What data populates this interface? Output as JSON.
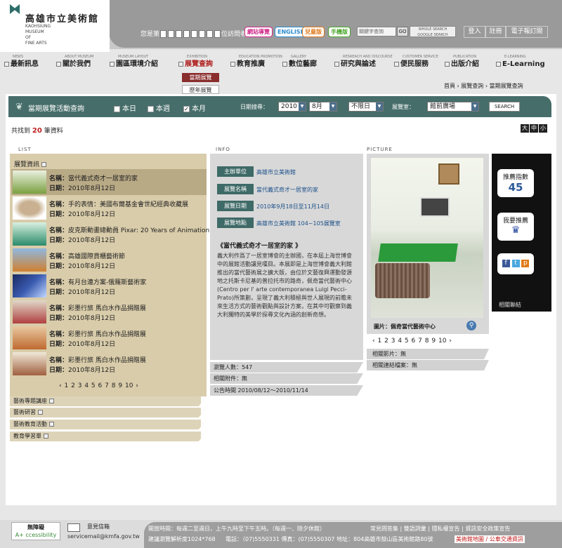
{
  "header": {
    "logo_cn": "高雄市立美術館",
    "logo_en": [
      "KAOHSIUNG",
      "MUSEUM",
      "OF",
      "FINE ARTS"
    ],
    "visitor_prefix": "您是第",
    "visitor_suffix": "位訪問者",
    "tag_buttons": [
      {
        "label": "網站導覽",
        "color": "#d02a8a"
      },
      {
        "label": "ENGLISH",
        "color": "#2a8ad0"
      },
      {
        "label": "兒童版",
        "color": "#e07a1a"
      },
      {
        "label": "手機版",
        "color": "#4aa62a"
      }
    ],
    "search_placeholder": "關鍵字查詢",
    "go_label": "GO",
    "whole_search": "WHOLE SEARCH",
    "google_search": "GOOGLE SEARCH",
    "right_buttons": [
      "登入",
      "註冊",
      "電子報訂閱"
    ]
  },
  "nav": [
    {
      "sub": "NEWS",
      "label": "最新訊息"
    },
    {
      "sub": "ABOUT MUSEUM",
      "label": "關於我們"
    },
    {
      "sub": "MUSEUM LAYOUT",
      "label": "園區環境介紹"
    },
    {
      "sub": "EXHIBITION",
      "label": "展覽查詢"
    },
    {
      "sub": "EDUCATION PROMOTION",
      "label": "教育推廣"
    },
    {
      "sub": "GALLERY",
      "label": "數位藝廊"
    },
    {
      "sub": "RESREACH AND DISCOURSE",
      "label": "研究與論述"
    },
    {
      "sub": "CUSTOMER SERVICE",
      "label": "便民服務"
    },
    {
      "sub": "PUBLICATION",
      "label": "出版介紹"
    },
    {
      "sub": "E-LEARNING",
      "label": "E-Learning"
    }
  ],
  "submenu": [
    "當期展覽",
    "歷年展覽"
  ],
  "breadcrumb": "首頁 › 展覽查詢 › 當期展覽查詢",
  "filter": {
    "title": "當期展覽活動查詢",
    "options": [
      {
        "label": "本日",
        "checked": false
      },
      {
        "label": "本週",
        "checked": false
      },
      {
        "label": "本月",
        "checked": true
      }
    ],
    "date_label": "日期搜尋：",
    "year": "2010",
    "month": "8月",
    "range": "不限日",
    "hall_label": "展覽室：",
    "hall": "館前廣場",
    "search_label": "SEARCH"
  },
  "found": {
    "prefix": "共找到",
    "count": "20",
    "suffix": "筆資料"
  },
  "font_sizes": [
    "大",
    "中",
    "小"
  ],
  "sections": {
    "list": "LIST",
    "info": "INFO",
    "picture": "PICTURE"
  },
  "list": {
    "header": "展覽資訊",
    "name_label": "名稱：",
    "date_label": "日期：",
    "items": [
      {
        "name": "當代義式奇才一居室的家",
        "date": "2010年8月12日",
        "thumb": "#7aa040"
      },
      {
        "name": "手的表情：美國布爾基金會世紀經典收藏展",
        "date": "2010年8月12日",
        "thumb": "#c8b090"
      },
      {
        "name": "皮克斯動畫總動員 Pixar: 20 Years of Animation",
        "date": "2010年8月12日",
        "thumb": "#2a8a6a"
      },
      {
        "name": "高雄國際貨櫃藝術節",
        "date": "2010年8月12日",
        "thumb": "#d08030"
      },
      {
        "name": "有月台連方案-俄羅斯藝術家",
        "date": "2010年8月12日",
        "thumb": "#3a5ab0"
      },
      {
        "name": "彩墨行旅 馬白水作品捐贈展",
        "date": "2010年8月12日",
        "thumb": "#b04040"
      },
      {
        "name": "彩墨行旅 馬白水作品捐贈展",
        "date": "2010年8月12日",
        "thumb": "#c06a30"
      },
      {
        "name": "彩墨行旅 馬白水作品捐贈展",
        "date": "2010年8月12日",
        "thumb": "#a06040"
      }
    ],
    "pagination": [
      "‹",
      "1",
      "2",
      "3",
      "4",
      "5",
      "6",
      "7",
      "8",
      "9",
      "10",
      "›"
    ],
    "categories": [
      "藝術專題講座",
      "藝術研習",
      "藝術教育活動",
      "教育學習單"
    ]
  },
  "info": {
    "rows": [
      {
        "label": "主辦單位",
        "value": "高雄市立美術館"
      },
      {
        "label": "展覽名稱",
        "value": "當代義式奇才一居室的家"
      },
      {
        "label": "展覽日期",
        "value": "2010年9月18日至11月14日"
      },
      {
        "label": "展覽地點",
        "value": "高雄市立美術館 104~105展覽室"
      }
    ],
    "desc_title": "《當代義式奇才一居室的家 》",
    "desc": "義大利作爲了一居室博會的主辦國，在本屆上海世博會中的展館活動讓見嘆目。本展即是上海世博會義大利館推出的當代藝術展之擴大版，由位於文藝復興運動發源地之托斯卡尼基的普拉托市的路奇，佩奇當代藝術中心(Centro per l' arte contemporanea Luigi Pecci-Prato)所策劃，呈現了義大利積極與世人展現的前瞻未來生活方式的藝術觀點與設計方案，在其中可觀察到義大利獨特的美學於探尋文化內涵的創新奇想。",
    "views": "瀏覽人數：547",
    "attachment": "相關附件：無",
    "announce": "公告時間 2010/08/12〜2010/11/14"
  },
  "picture": {
    "caption": "圖片：佩奇當代藝術中心",
    "pagination": [
      "‹",
      "1",
      "2",
      "3",
      "4",
      "5",
      "6",
      "7",
      "8",
      "9",
      "10",
      "›"
    ],
    "video": "相關影片：無",
    "links": "相關連結檔案：無"
  },
  "recommend": {
    "title": "推薦指數",
    "score": "45",
    "recommend_label": "我要推薦",
    "related": "相關聯結"
  },
  "footer": {
    "accessibility": "無障礙",
    "mail_label": "意見信箱",
    "email": "servicemail@kmfa.gov.tw",
    "hours": "開放時間：每週二至週日，上午九時至下午五時。（每週一、除夕休館）",
    "resolution": "建議瀏覽解析度1024*768",
    "phone": "電話：（07)5550331 傳真：(07)5550307 地址：804高雄市鼓山區美術館路80號",
    "links": [
      "常見問答集",
      "雙語詞彙",
      "隱私權宣告",
      "資訊安全政策宣告"
    ],
    "map": "美術館地圖 / 公車交通資訊"
  }
}
